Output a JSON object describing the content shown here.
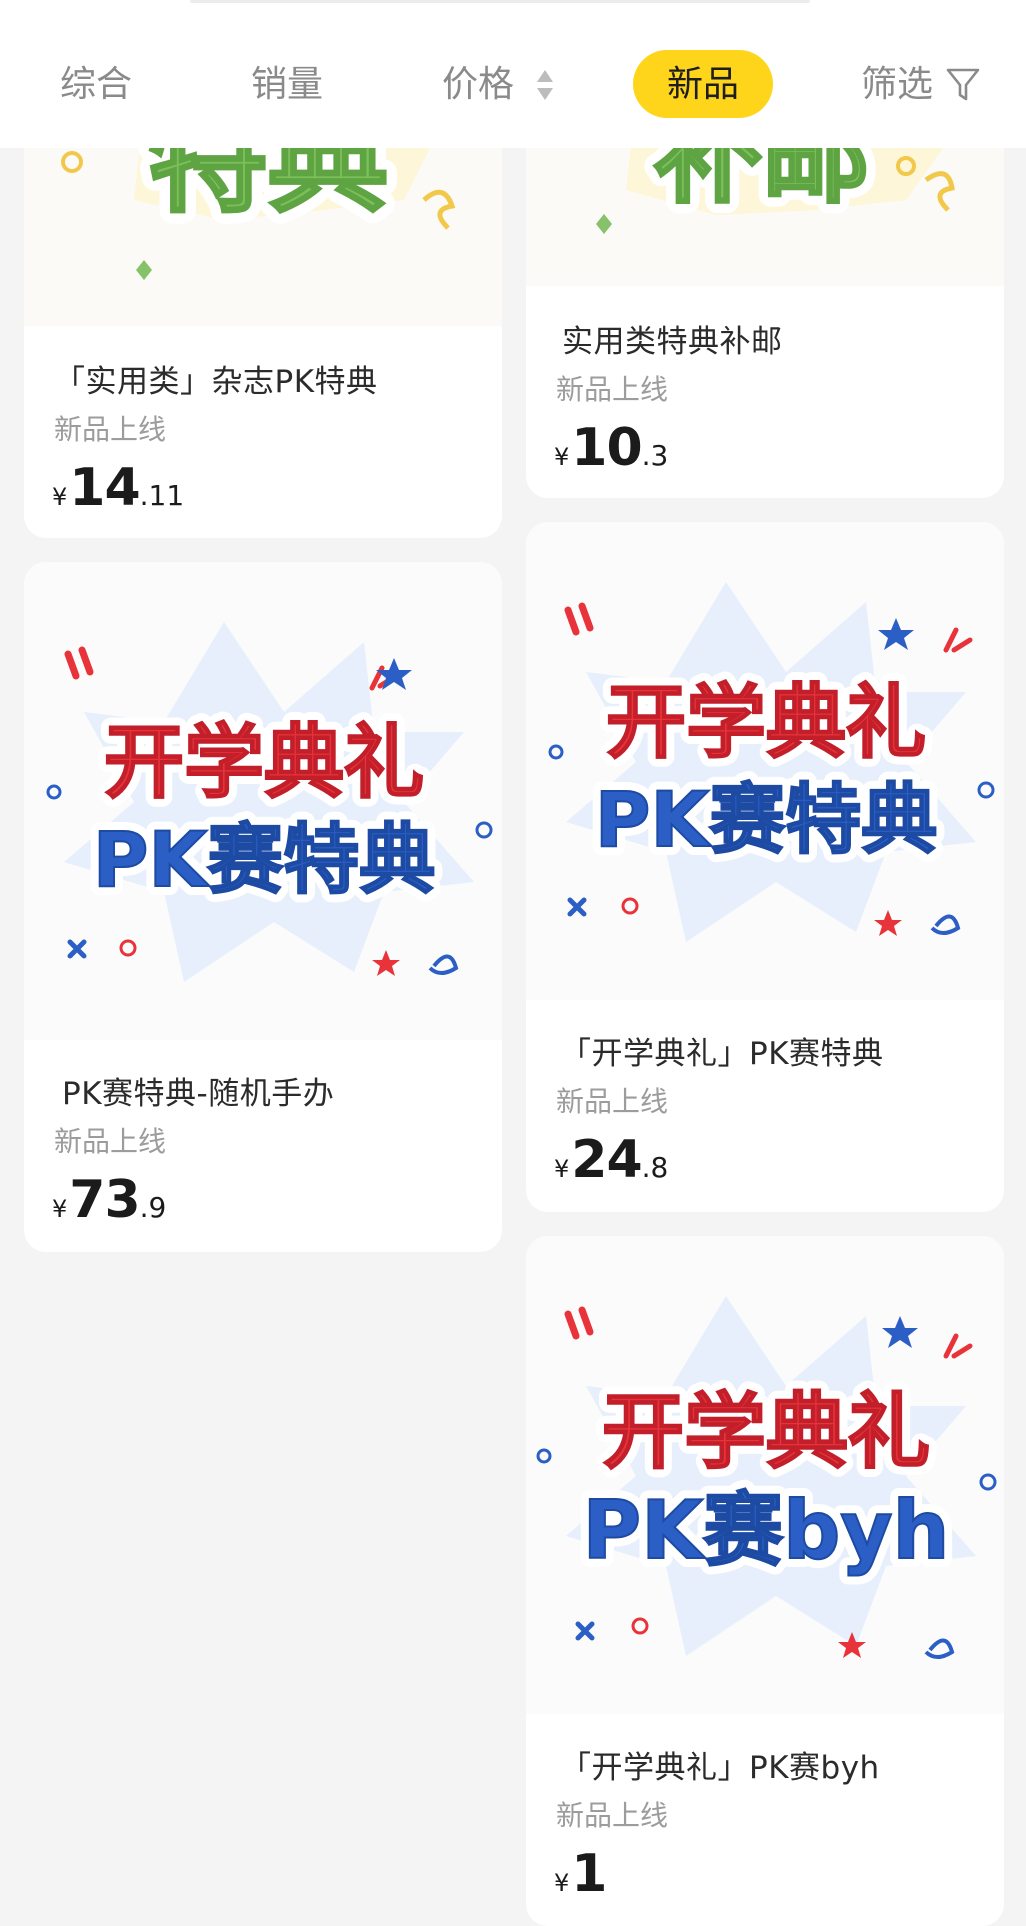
{
  "sort_bar": {
    "tabs": [
      {
        "label": "综合",
        "active": false
      },
      {
        "label": "销量",
        "active": false
      },
      {
        "label": "价格",
        "active": false
      },
      {
        "label": "新品",
        "active": true
      },
      {
        "label": "筛选",
        "active": false
      }
    ]
  },
  "products": [
    {
      "banner_text": "特典",
      "title": "「实用类」杂志PK特典",
      "tag": "新品上线",
      "price_currency": "¥",
      "price_int": "14",
      "price_dec": ".11"
    },
    {
      "banner_text": "补邮",
      "title": "实用类特典补邮",
      "tag": "新品上线",
      "price_currency": "¥",
      "price_int": "10",
      "price_dec": ".3"
    },
    {
      "banner_line1": "开学典礼",
      "banner_line2": "PK赛特典",
      "title": "PK赛特典-随机手办",
      "tag": "新品上线",
      "price_currency": "¥",
      "price_int": "73",
      "price_dec": ".9"
    },
    {
      "banner_line1": "开学典礼",
      "banner_line2": "PK赛特典",
      "title": "「开学典礼」PK赛特典",
      "tag": "新品上线",
      "price_currency": "¥",
      "price_int": "24",
      "price_dec": ".8"
    },
    {
      "banner_line1": "开学典礼",
      "banner_line2": "PK赛byh",
      "title": "「开学典礼」PK赛byh",
      "tag": "新品上线",
      "price_currency": "¥",
      "price_int": "1",
      "price_dec": ""
    }
  ],
  "colors": {
    "accent": "#ffd51c",
    "banner_red": "#e8333a",
    "banner_blue": "#2b5fc6",
    "banner_green": "#7cc05a"
  }
}
